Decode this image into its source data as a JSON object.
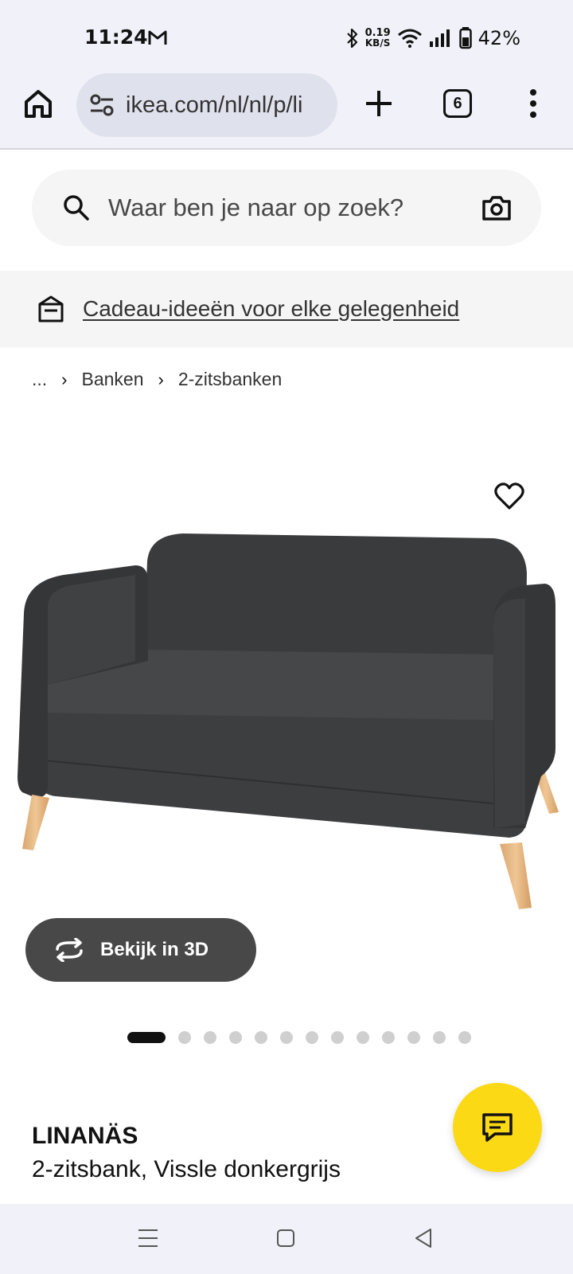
{
  "status_bar": {
    "time": "11:24",
    "net_speed_value": "0.19",
    "net_speed_unit": "KB/S",
    "battery": "42%"
  },
  "browser": {
    "url": "ikea.com/nl/nl/p/li",
    "tab_count": "6"
  },
  "search": {
    "placeholder": "Waar ben je naar op zoek?"
  },
  "promo": {
    "link_text": "Cadeau-ideeën voor elke gelegenheid"
  },
  "breadcrumb": {
    "items": [
      "...",
      "Banken",
      "2-zitsbanken"
    ]
  },
  "product": {
    "view_3d_label": "Bekijk in 3D",
    "carousel_total": 13,
    "carousel_active": 0,
    "name": "LINANÄS",
    "description": "2-zitsbank, Vissle donkergrijs",
    "sofa_color": "#3f4042",
    "leg_color": "#e2b585"
  },
  "colors": {
    "accent_yellow": "#fbd914",
    "dark_button": "#484848"
  }
}
